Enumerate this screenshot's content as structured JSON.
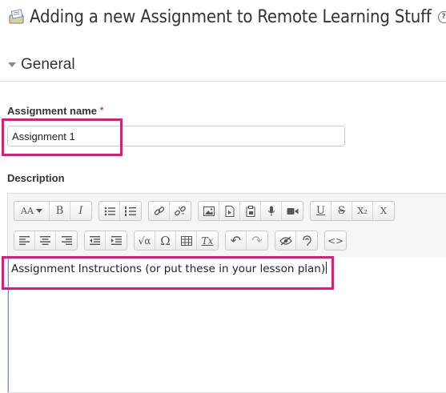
{
  "page": {
    "title": "Adding a new Assignment to Remote Learning Stuff",
    "help_icon": "?"
  },
  "section": {
    "title": "General"
  },
  "assignment_name": {
    "label": "Assignment name",
    "required_mark": "*",
    "value": "Assignment 1"
  },
  "description": {
    "label": "Description",
    "content": "Assignment Instructions (or put these in your lesson plan)"
  },
  "toolbar": {
    "row1": [
      [
        "font-size-icon"
      ],
      [
        "bold-icon",
        "italic-icon"
      ],
      [
        "bullet-list-icon",
        "numbered-list-icon"
      ],
      [
        "link-icon",
        "unlink-icon"
      ],
      [
        "image-icon",
        "media-icon",
        "manage-files-icon",
        "record-audio-icon",
        "record-video-icon"
      ],
      [
        "underline-icon",
        "strikethrough-icon",
        "subscript-icon",
        "superscript-icon"
      ]
    ],
    "row2": [
      [
        "align-left-icon",
        "align-center-icon",
        "align-right-icon"
      ],
      [
        "outdent-icon",
        "indent-icon"
      ],
      [
        "equation-icon",
        "special-character-icon",
        "table-icon",
        "clear-formatting-icon"
      ],
      [
        "undo-icon",
        "redo-icon"
      ],
      [
        "accessibility-checker-icon",
        "screenreader-helper-icon"
      ],
      [
        "html-icon"
      ]
    ],
    "glyphs": {
      "bold": "B",
      "italic": "I",
      "underline": "U",
      "strike": "S",
      "subscript": "X₂",
      "superscript": "X",
      "equation": "√α",
      "omega": "Ω",
      "clear": "Tx",
      "undo": "↶",
      "redo": "↷",
      "html": "<>",
      "font": "AA"
    }
  },
  "colors": {
    "highlight": "#e6157c",
    "required": "#c0392b",
    "caret_focus": "#6b8fd6"
  }
}
